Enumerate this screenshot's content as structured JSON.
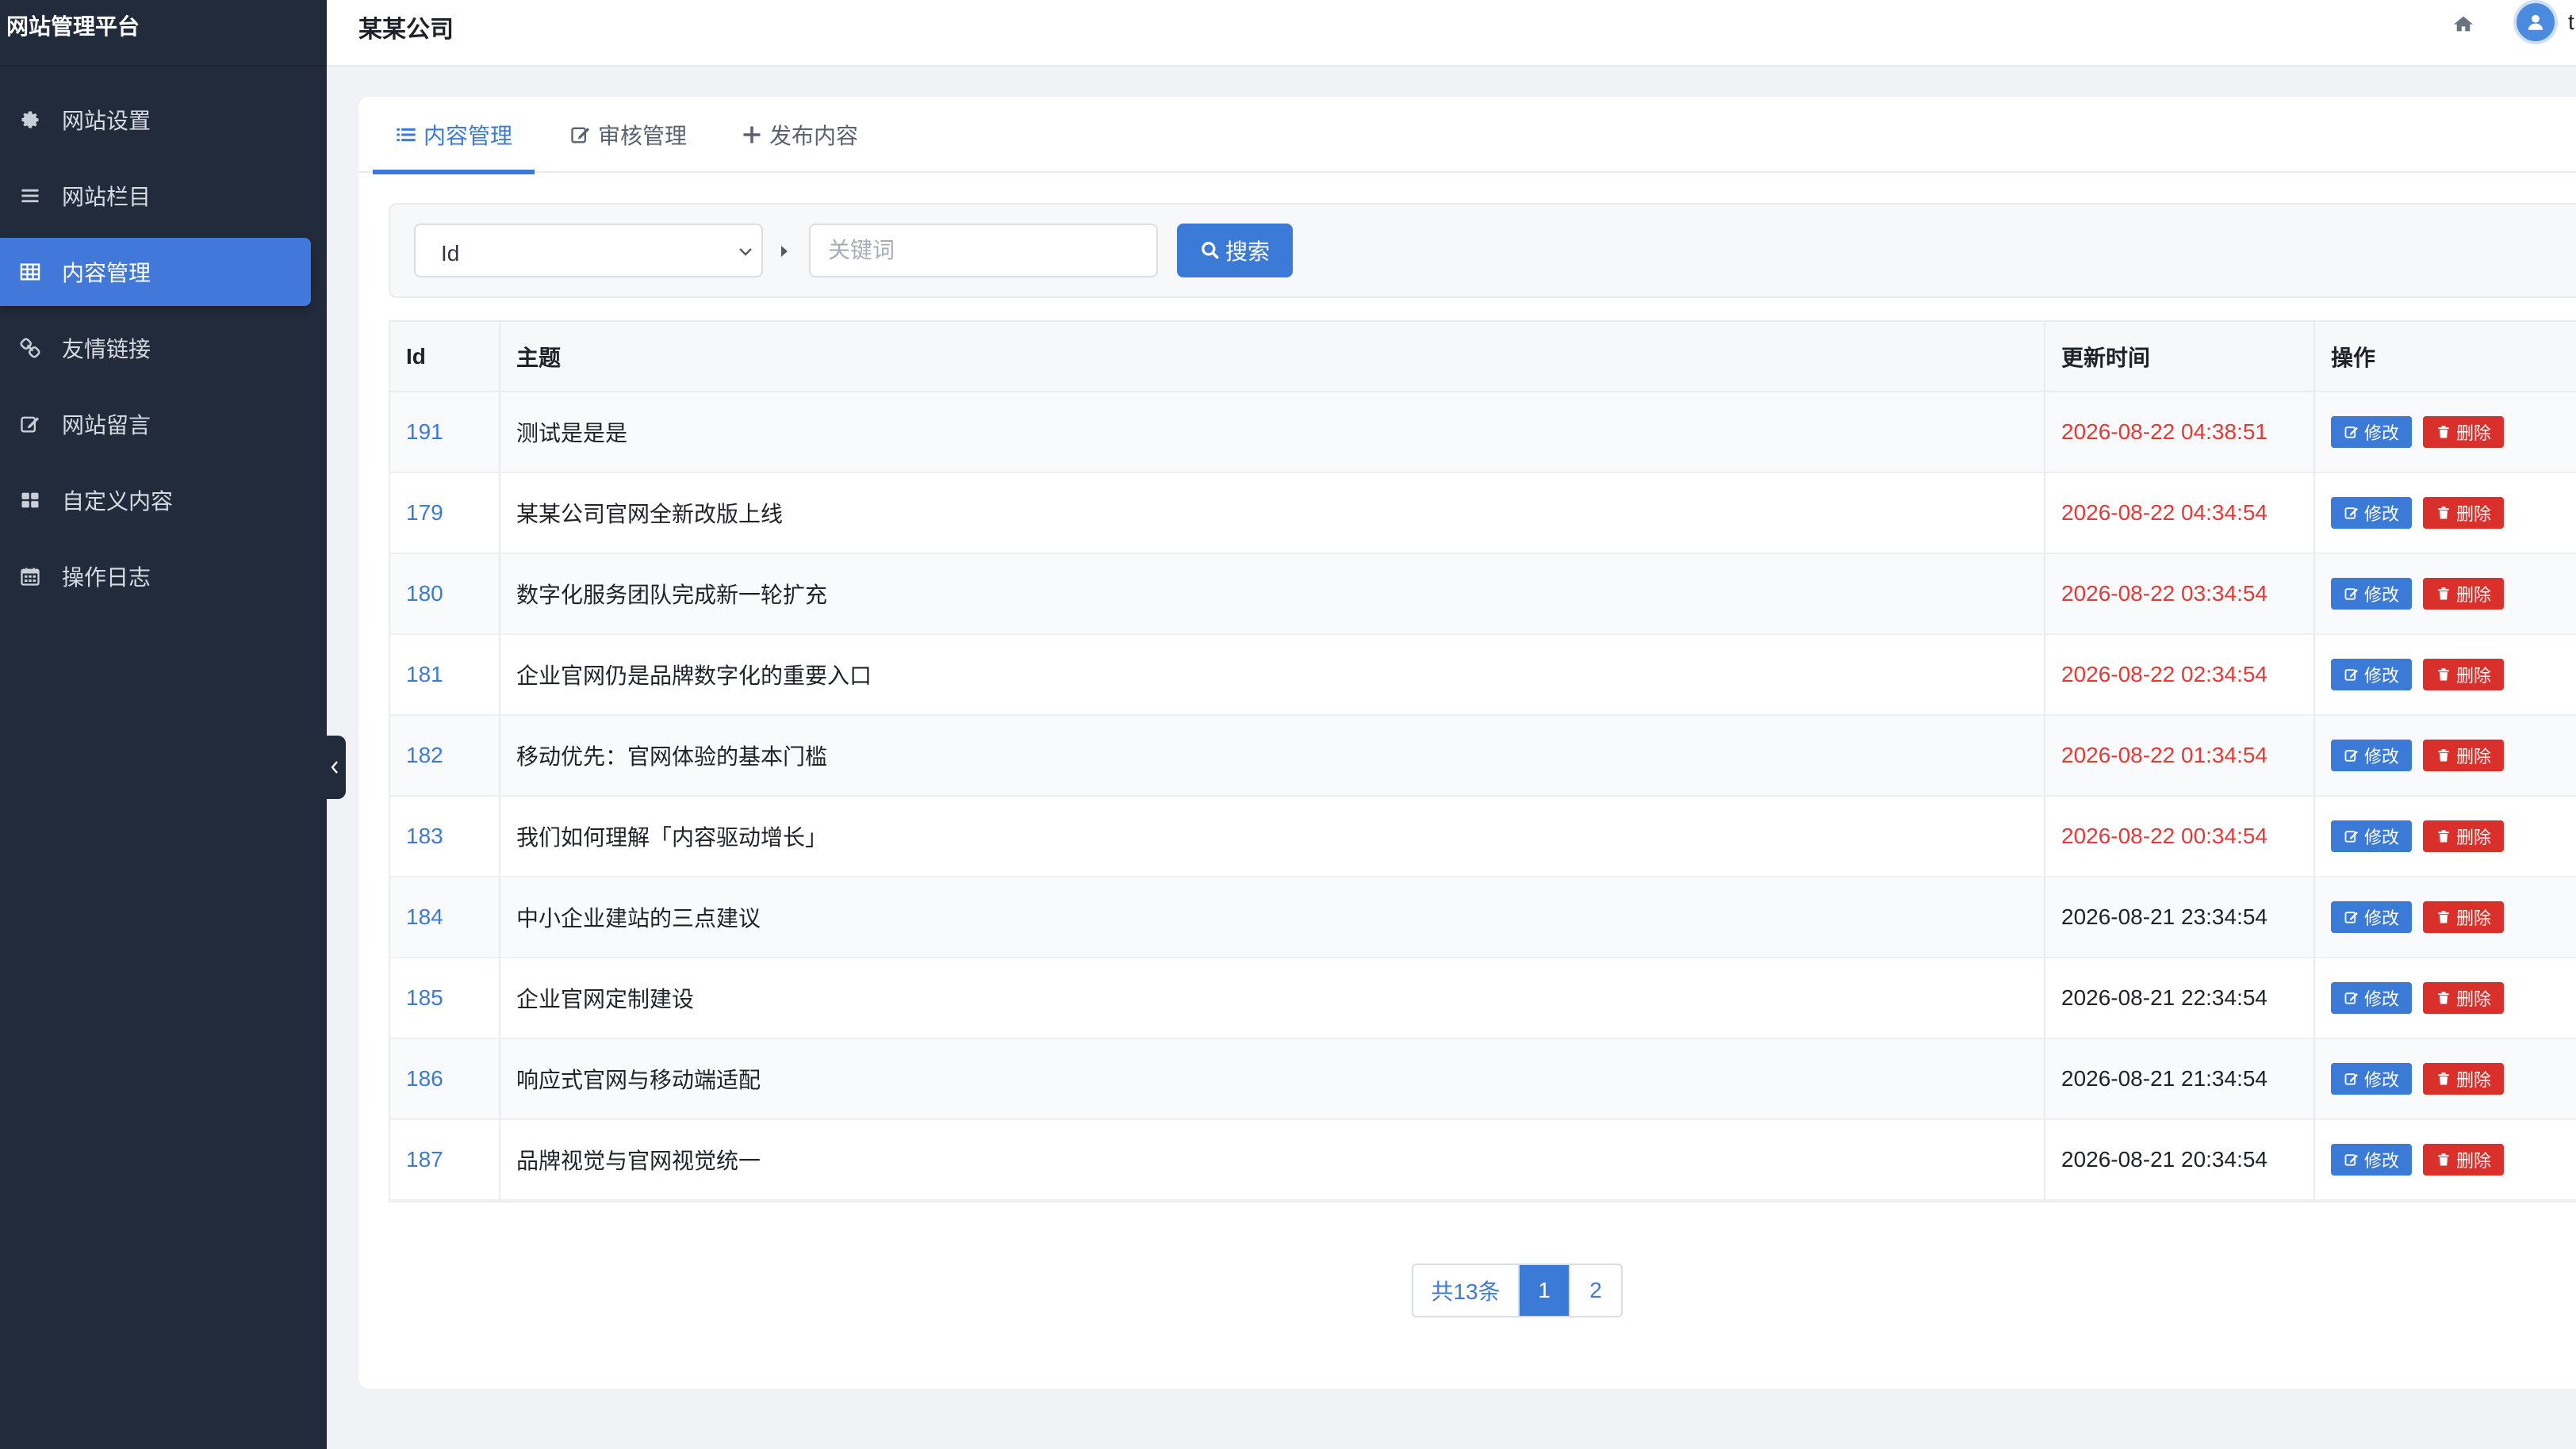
{
  "brand": "网站管理平台",
  "company": "某某公司",
  "user_initial": "t",
  "sidebar": {
    "items": [
      {
        "label": "网站设置",
        "icon": "gear-icon"
      },
      {
        "label": "网站栏目",
        "icon": "list-icon"
      },
      {
        "label": "内容管理",
        "icon": "table-icon",
        "active": true
      },
      {
        "label": "友情链接",
        "icon": "link-icon"
      },
      {
        "label": "网站留言",
        "icon": "edit-icon"
      },
      {
        "label": "自定义内容",
        "icon": "grid-icon"
      },
      {
        "label": "操作日志",
        "icon": "calendar-icon"
      }
    ]
  },
  "tabs": [
    {
      "label": "内容管理",
      "icon": "list-icon",
      "active": true
    },
    {
      "label": "审核管理",
      "icon": "edit-icon"
    },
    {
      "label": "发布内容",
      "icon": "plus-icon"
    }
  ],
  "search": {
    "field_selected": "Id",
    "keyword_value": "",
    "keyword_placeholder": "关键词",
    "button_label": "搜索"
  },
  "table": {
    "columns": [
      "Id",
      "主题",
      "更新时间",
      "操作"
    ],
    "edit_label": "修改",
    "delete_label": "删除",
    "rows": [
      {
        "id": "191",
        "title": "测试是是是",
        "updated": "2026-08-22 04:38:51",
        "recent": true
      },
      {
        "id": "179",
        "title": "某某公司官网全新改版上线",
        "updated": "2026-08-22 04:34:54",
        "recent": true
      },
      {
        "id": "180",
        "title": "数字化服务团队完成新一轮扩充",
        "updated": "2026-08-22 03:34:54",
        "recent": true
      },
      {
        "id": "181",
        "title": "企业官网仍是品牌数字化的重要入口",
        "updated": "2026-08-22 02:34:54",
        "recent": true
      },
      {
        "id": "182",
        "title": "移动优先：官网体验的基本门槛",
        "updated": "2026-08-22 01:34:54",
        "recent": true
      },
      {
        "id": "183",
        "title": "我们如何理解「内容驱动增长」",
        "updated": "2026-08-22 00:34:54",
        "recent": true
      },
      {
        "id": "184",
        "title": "中小企业建站的三点建议",
        "updated": "2026-08-21 23:34:54",
        "recent": false
      },
      {
        "id": "185",
        "title": "企业官网定制建设",
        "updated": "2026-08-21 22:34:54",
        "recent": false
      },
      {
        "id": "186",
        "title": "响应式官网与移动端适配",
        "updated": "2026-08-21 21:34:54",
        "recent": false
      },
      {
        "id": "187",
        "title": "品牌视觉与官网视觉统一",
        "updated": "2026-08-21 20:34:54",
        "recent": false
      }
    ]
  },
  "pagination": {
    "total_label": "共13条",
    "pages": [
      "1",
      "2"
    ],
    "current": "1"
  },
  "colors": {
    "accent": "#3c7ad8",
    "danger": "#d9302c",
    "recent_time": "#e53935",
    "sidebar_bg": "#222b3b"
  }
}
